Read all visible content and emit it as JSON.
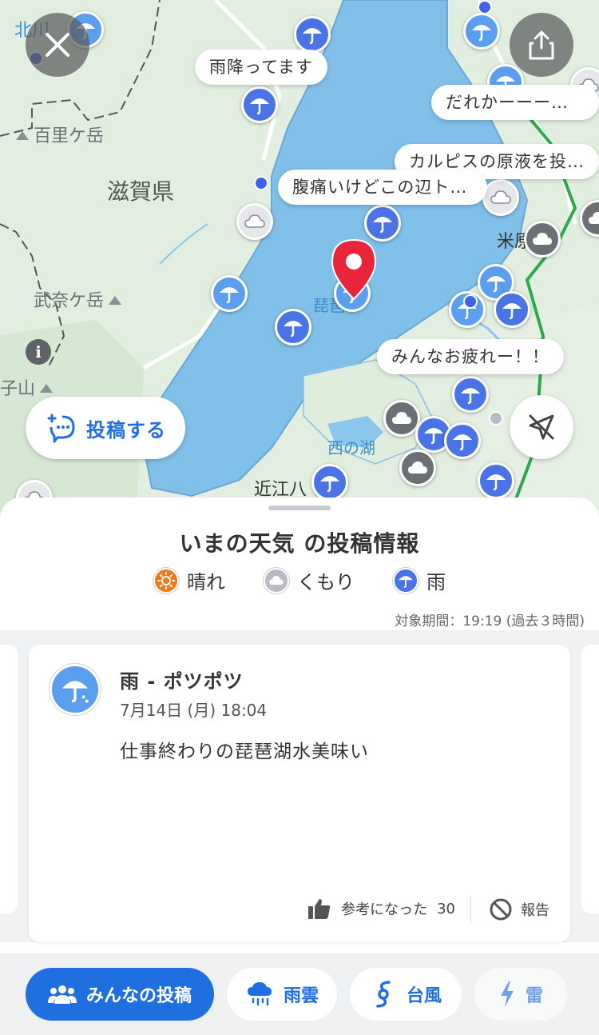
{
  "map": {
    "labels": {
      "kitagawa": "北川",
      "prefecture": "滋賀県",
      "hyakuri": "百里ケ岳",
      "bunagatake": "武奈ケ岳",
      "shiko": "子山",
      "biwako": "琵琶",
      "nishinoko": "西の湖",
      "omi": "近江八",
      "maibara": "米原"
    },
    "bubbles": [
      "雨降ってます",
      "だれかーーー！！！",
      "カルピスの原液を投入したい",
      "腹痛いけどこの辺トイレない",
      "みんなお疲れー！！"
    ],
    "post_button_label": "投稿する"
  },
  "sheet": {
    "title": "いまの天気 の投稿情報",
    "legend": [
      {
        "label": "晴れ",
        "icon": "sun-icon",
        "color": "#f07a1a"
      },
      {
        "label": "くもり",
        "icon": "cloud-icon",
        "color": "#b8bcc2"
      },
      {
        "label": "雨",
        "icon": "umbrella-icon",
        "color": "#4a74e6"
      }
    ],
    "period": "対象期間：19:19 (過去３時間)"
  },
  "card": {
    "title": "雨 - ポツポツ",
    "date": "7月14日 (月) 18:04",
    "body": "仕事終わりの琵琶湖水美味い",
    "helpful_label": "参考になった",
    "helpful_count": "30",
    "report_label": "報告"
  },
  "tabs": [
    {
      "label": "みんなの投稿",
      "icon": "people-icon"
    },
    {
      "label": "雨雲",
      "icon": "rain-cloud-icon"
    },
    {
      "label": "台風",
      "icon": "typhoon-icon"
    },
    {
      "label": "雷",
      "icon": "lightning-icon"
    }
  ],
  "colors": {
    "accent": "#1f6fe0",
    "rain": "#4a74e6",
    "lake": "#7fbfe8",
    "pin": "#e8253a"
  }
}
